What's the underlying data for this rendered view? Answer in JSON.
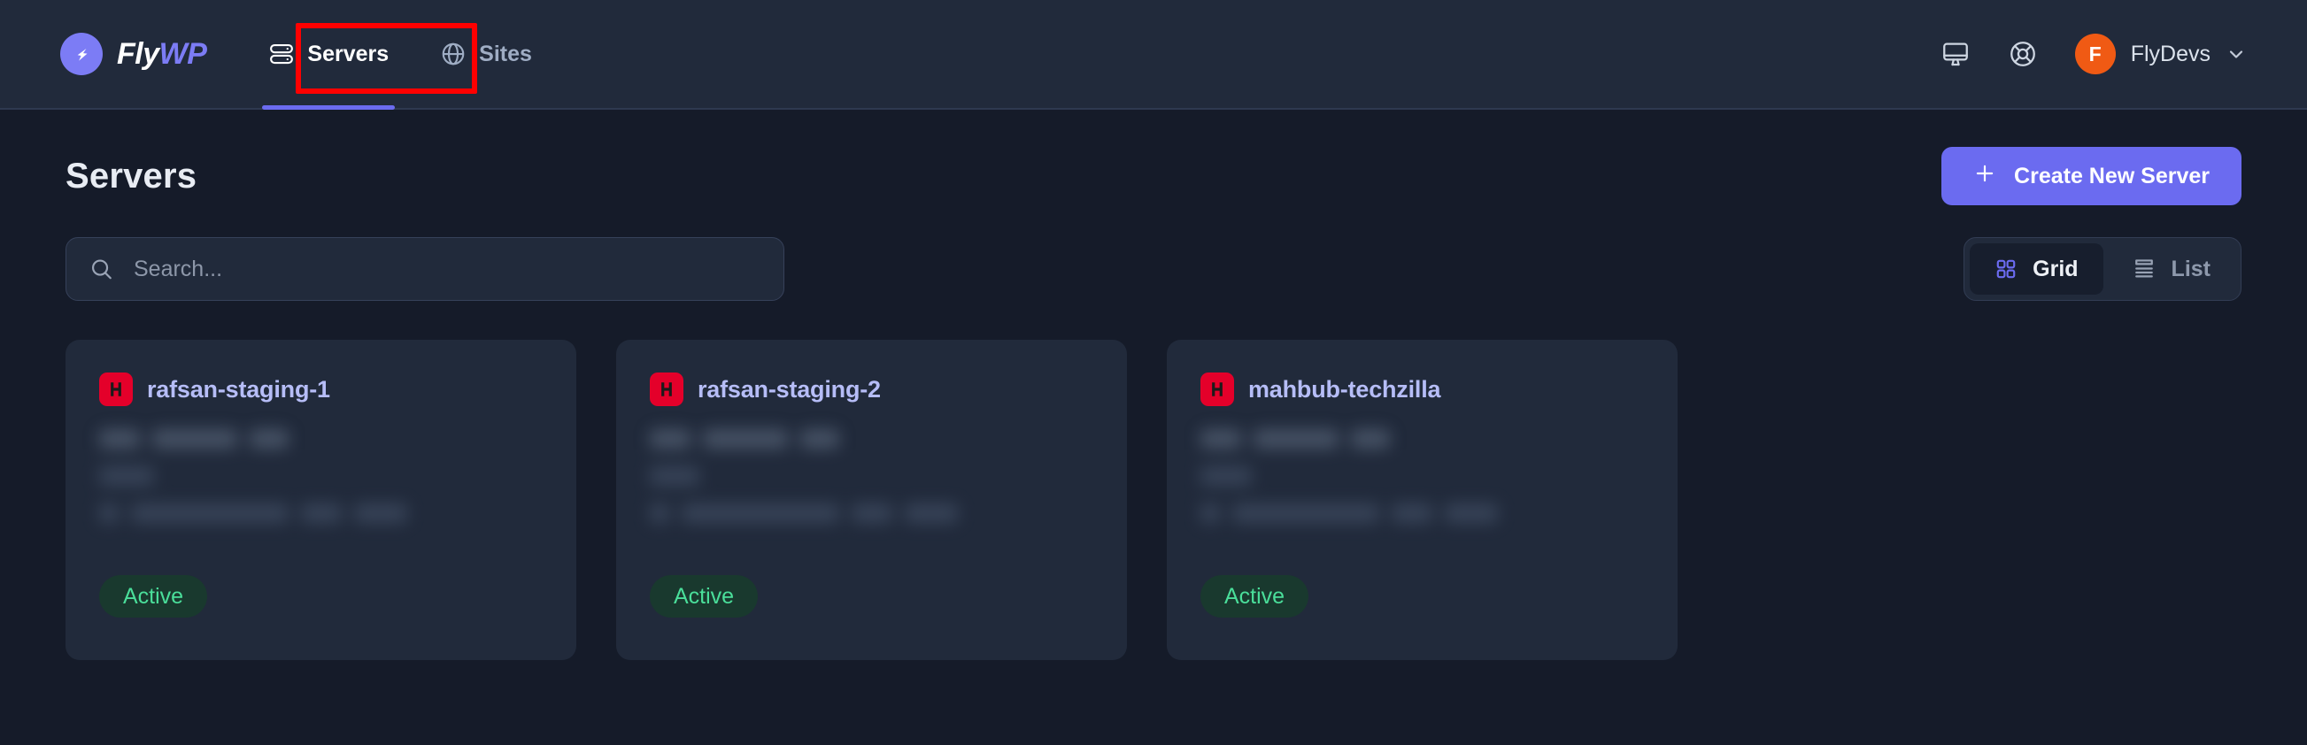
{
  "brand": {
    "name_part1": "Fly",
    "name_part2": "WP",
    "logo_icon": "flywp-arrow-logo"
  },
  "header": {
    "nav": [
      {
        "label": "Servers",
        "icon": "server-stack-icon",
        "active": true
      },
      {
        "label": "Sites",
        "icon": "globe-icon",
        "active": false
      }
    ],
    "actions": [
      {
        "icon": "monitor-icon",
        "name": "monitor-button"
      },
      {
        "icon": "lifebuoy-icon",
        "name": "support-button"
      }
    ],
    "account": {
      "initial": "F",
      "name": "FlyDevs",
      "caret_icon": "chevron-down-icon",
      "avatar_color": "#f05a14"
    }
  },
  "main": {
    "title": "Servers",
    "create_button": {
      "label": "Create New Server",
      "icon": "plus-icon",
      "color": "#6b6bf0"
    },
    "search": {
      "value": "",
      "placeholder": "Search...",
      "icon": "search-icon"
    },
    "view_toggle": {
      "grid": {
        "label": "Grid",
        "icon": "grid-icon",
        "selected": true
      },
      "list": {
        "label": "List",
        "icon": "list-icon",
        "selected": false
      }
    },
    "servers": [
      {
        "name": "rafsan-staging-1",
        "provider_icon": "hetzner-h-logo",
        "status": "Active",
        "status_color": "#4ade9a"
      },
      {
        "name": "rafsan-staging-2",
        "provider_icon": "hetzner-h-logo",
        "status": "Active",
        "status_color": "#4ade9a"
      },
      {
        "name": "mahbub-techzilla",
        "provider_icon": "hetzner-h-logo",
        "status": "Active",
        "status_color": "#4ade9a"
      }
    ]
  },
  "annotation": {
    "shape": "rectangle",
    "color": "#ff0000",
    "target": "Servers"
  }
}
